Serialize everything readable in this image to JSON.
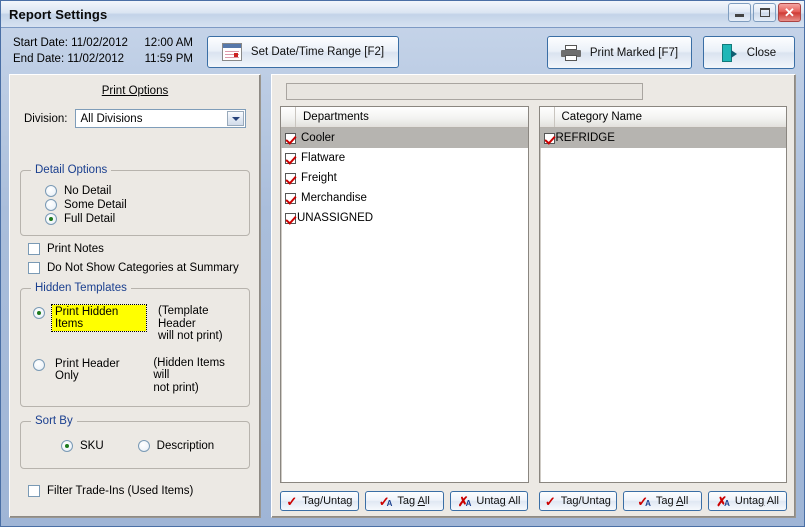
{
  "window": {
    "title": "Report Settings",
    "minimize_label": "Minimize",
    "maximize_label": "Maximize",
    "close_label": "✕"
  },
  "toolbar": {
    "start_date_label": "Start Date: 11/02/2012",
    "start_time": "12:00 AM",
    "end_date_label": "End Date: 11/02/2012",
    "end_time": "11:59 PM",
    "date_range_button": "Set Date/Time Range [F2]",
    "print_button": "Print Marked [F7]",
    "close_button": "Close"
  },
  "print_options": {
    "header": "Print Options",
    "division_label": "Division:",
    "division_value": "All Divisions",
    "detail_group_label": "Detail Options",
    "detail_options": [
      {
        "label": "No Detail",
        "selected": false
      },
      {
        "label": "Some Detail",
        "selected": false
      },
      {
        "label": "Full Detail",
        "selected": true
      }
    ],
    "print_notes": {
      "label": "Print Notes",
      "checked": false
    },
    "no_categories_summary": {
      "label": "Do Not Show Categories at Summary",
      "checked": false
    },
    "hidden_group_label": "Hidden Templates",
    "hidden_options": [
      {
        "label": "Print Hidden Items",
        "selected": true,
        "highlighted": true,
        "note_line1": "(Template Header",
        "note_line2": "will not print)"
      },
      {
        "label": "Print Header Only",
        "selected": false,
        "highlighted": false,
        "note_line1": "(Hidden Items will",
        "note_line2": "not print)"
      }
    ],
    "sort_group_label": "Sort By",
    "sort_options": [
      {
        "label": "SKU",
        "selected": true
      },
      {
        "label": "Description",
        "selected": false
      }
    ],
    "filter_trade_ins": {
      "label": "Filter Trade-Ins (Used Items)",
      "checked": false
    }
  },
  "departments": {
    "filter_value": "",
    "column_header": "Departments",
    "rows": [
      {
        "label": "Cooler",
        "checked": true,
        "selected": true
      },
      {
        "label": "Flatware",
        "checked": true,
        "selected": false
      },
      {
        "label": "Freight",
        "checked": true,
        "selected": false
      },
      {
        "label": "Merchandise",
        "checked": true,
        "selected": false
      },
      {
        "label": "UNASSIGNED",
        "checked": true,
        "selected": false
      }
    ],
    "buttons": {
      "tag_untag": "Tag/Untag",
      "tag_all_pre": "Tag ",
      "tag_all_acc": "A",
      "tag_all_post": "ll",
      "untag_all_pre": "Unta",
      "untag_all_acc": "g",
      "untag_all_post": " All"
    }
  },
  "categories": {
    "column_header": "Category Name",
    "rows": [
      {
        "label": "REFRIDGE",
        "checked": true,
        "selected": true
      }
    ],
    "buttons": {
      "tag_untag": "Tag/Untag",
      "tag_all_pre": "Tag ",
      "tag_all_acc": "A",
      "tag_all_post": "ll",
      "untag_all_pre": "Unta",
      "untag_all_acc": "g",
      "untag_all_post": " All"
    }
  },
  "colors": {
    "highlight_yellow": "#ffff00",
    "check_red": "#cc0000",
    "group_label_blue": "#1a3f8f",
    "selection_gray": "#b6b4b0"
  }
}
